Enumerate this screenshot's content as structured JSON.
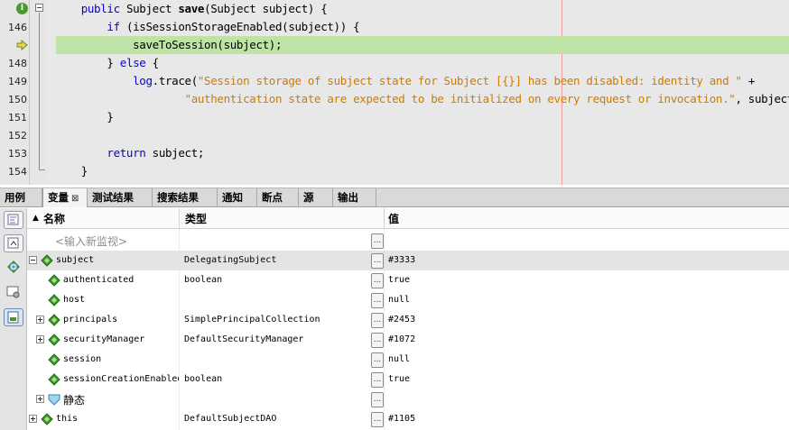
{
  "editor": {
    "lines": [
      {
        "number": "",
        "marker": "info",
        "fold": "open",
        "tokens": [
          {
            "t": "    "
          },
          {
            "t": "public",
            "c": "kw"
          },
          {
            "t": " Subject "
          },
          {
            "t": "save",
            "c": "b"
          },
          {
            "t": "(Subject subject) {"
          }
        ]
      },
      {
        "number": "146",
        "tokens": [
          {
            "t": "        "
          },
          {
            "t": "if",
            "c": "kw"
          },
          {
            "t": " (isSessionStorageEnabled(subject)) {"
          }
        ]
      },
      {
        "number": "",
        "marker": "arrow",
        "current": true,
        "tokens": [
          {
            "t": "            saveToSession(subject);"
          }
        ]
      },
      {
        "number": "148",
        "tokens": [
          {
            "t": "        } "
          },
          {
            "t": "else",
            "c": "kw"
          },
          {
            "t": " {"
          }
        ]
      },
      {
        "number": "149",
        "tokens": [
          {
            "t": "            "
          },
          {
            "t": "log",
            "c": "kw"
          },
          {
            "t": ".trace("
          },
          {
            "t": "\"Session storage of subject state for Subject [{}] has been disabled: identity and \"",
            "c": "str"
          },
          {
            "t": " +"
          }
        ]
      },
      {
        "number": "150",
        "tokens": [
          {
            "t": "                    "
          },
          {
            "t": "\"authentication state are expected to be initialized on every request or invocation.\"",
            "c": "str"
          },
          {
            "t": ", subject);"
          }
        ]
      },
      {
        "number": "151",
        "tokens": [
          {
            "t": "        }"
          }
        ]
      },
      {
        "number": "152",
        "tokens": [
          {
            "t": ""
          }
        ]
      },
      {
        "number": "153",
        "tokens": [
          {
            "t": "        "
          },
          {
            "t": "return",
            "c": "kw"
          },
          {
            "t": " subject;"
          }
        ]
      },
      {
        "number": "154",
        "fold": "end",
        "tokens": [
          {
            "t": "    }"
          }
        ]
      }
    ]
  },
  "tabs": [
    {
      "label": "用例",
      "active": false
    },
    {
      "label": "变量",
      "active": true,
      "close": "⊠"
    },
    {
      "label": "测试结果",
      "active": false
    },
    {
      "label": "搜索结果",
      "active": false
    },
    {
      "label": "通知",
      "active": false
    },
    {
      "label": "断点",
      "active": false
    },
    {
      "label": "源",
      "active": false
    },
    {
      "label": "输出",
      "active": false
    }
  ],
  "toolbar": {
    "buttons": [
      "watch-add-icon",
      "watch-view-icon",
      "new-watch-icon",
      "settings-icon",
      "table-view-icon"
    ]
  },
  "table": {
    "headers": {
      "name": "名称",
      "type": "类型",
      "value": "值"
    },
    "sort_indicator": "▲",
    "watch_placeholder": "<输入新监视>",
    "dots_label": "...",
    "rows": [
      {
        "indent": 0,
        "expander": "minus",
        "icon": "field",
        "name": "subject",
        "type": "DelegatingSubject",
        "value": "#3333",
        "selected": true
      },
      {
        "indent": 1,
        "expander": "",
        "icon": "field",
        "name": "authenticated",
        "type": "boolean",
        "value": "true"
      },
      {
        "indent": 1,
        "expander": "",
        "icon": "field",
        "name": "host",
        "type": "",
        "value": "null"
      },
      {
        "indent": 1,
        "expander": "plus",
        "icon": "field",
        "name": "principals",
        "type": "SimplePrincipalCollection",
        "value": "#2453"
      },
      {
        "indent": 1,
        "expander": "plus",
        "icon": "field",
        "name": "securityManager",
        "type": "DefaultSecurityManager",
        "value": "#1072"
      },
      {
        "indent": 1,
        "expander": "",
        "icon": "field",
        "name": "session",
        "type": "",
        "value": "null"
      },
      {
        "indent": 1,
        "expander": "",
        "icon": "field",
        "name": "sessionCreationEnabled",
        "type": "boolean",
        "value": "true"
      },
      {
        "indent": 1,
        "expander": "plus",
        "icon": "static",
        "name": "静态",
        "type": "",
        "value": "",
        "cjk": true
      },
      {
        "indent": 0,
        "expander": "plus",
        "icon": "field",
        "name": "this",
        "type": "DefaultSubjectDAO",
        "value": "#1105"
      }
    ]
  },
  "colors": {
    "keyword": "#0000e6",
    "string": "#ce7b00",
    "current_line": "#bfe3a6",
    "field_icon": "#3d9a2a"
  }
}
